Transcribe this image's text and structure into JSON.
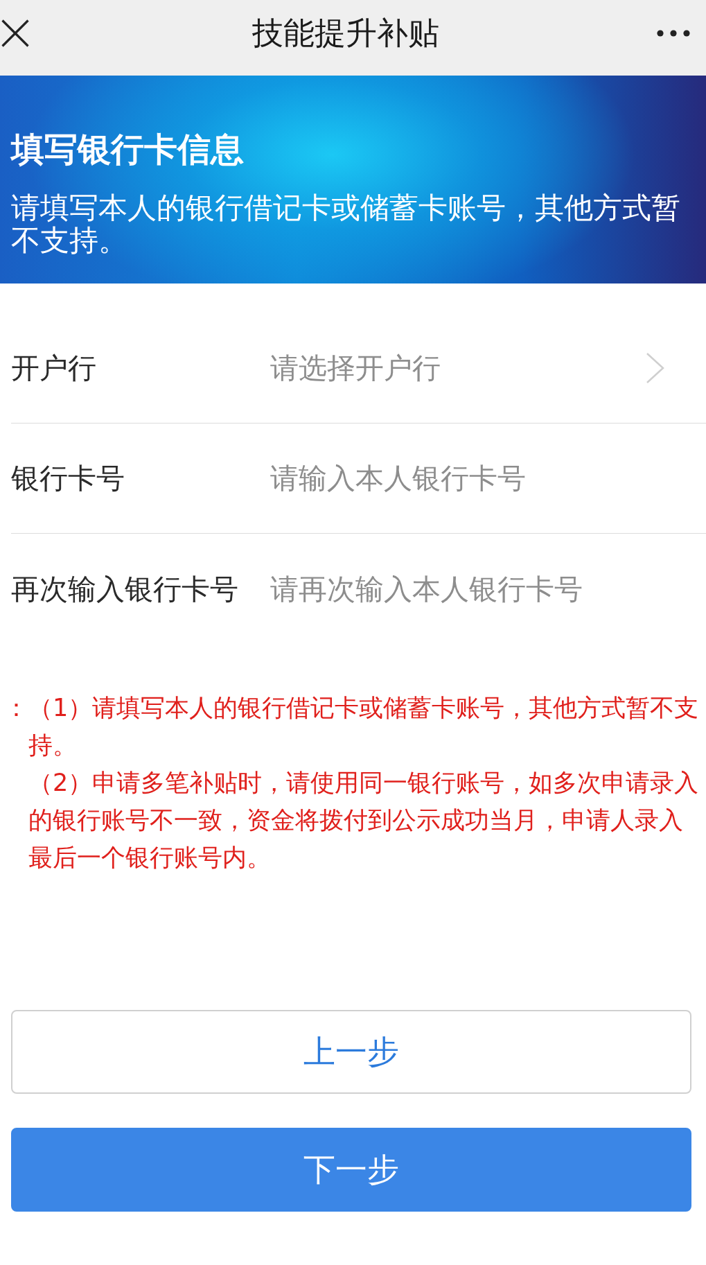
{
  "nav_bar": {
    "title": "技能提升补贴"
  },
  "banner": {
    "heading": "填写银行卡信息",
    "text": "请填写本人的银行借记卡或储蓄卡账号，其他方式暂不支持。"
  },
  "form": {
    "rows": [
      {
        "kind": "select",
        "label": "开户行",
        "placeholder": "请选择开户行"
      },
      {
        "kind": "input",
        "label": "银行卡号",
        "placeholder": "请输入本人银行卡号"
      },
      {
        "kind": "input",
        "label": "再次输入银行卡号",
        "placeholder": "请再次输入本人银行卡号"
      }
    ]
  },
  "notice": {
    "lines": [
      "：（1）请填写本人的银行借记卡或储蓄卡账号，其他方式暂不支",
      "持。",
      "（2）申请多笔补贴时，请使用同一银行账号，如多次申请录入",
      "的银行账号不一致，资金将拨付到公示成功当月，申请人录入",
      "最后一个银行账号内。"
    ]
  },
  "buttons": [
    {
      "kind": "secondary",
      "label": "上一步"
    },
    {
      "kind": "primary",
      "label": "下一步"
    }
  ]
}
